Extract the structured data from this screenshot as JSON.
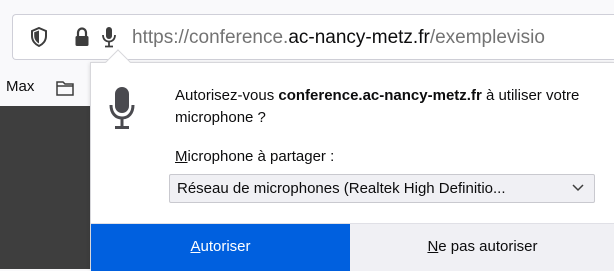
{
  "url": {
    "scheme": "https://",
    "prefix": "conference.",
    "host": "ac-nancy-metz.fr",
    "path": "/exemplevisio"
  },
  "bookmarks": {
    "label": "Max"
  },
  "icons": {
    "shield": "shield-icon",
    "lock": "lock-icon",
    "mic": "microphone-icon",
    "folder": "folder-icon",
    "chevron": "chevron-down-icon"
  },
  "prompt": {
    "text_before": "Autorisez-vous ",
    "domain": "conference.ac-nancy-metz.fr",
    "text_after": " à utiliser votre microphone ?",
    "share_label_key": "M",
    "share_label_rest": "icrophone à partager :",
    "selected_device": "Réseau de microphones (Realtek High Definitio...",
    "allow_key": "A",
    "allow_rest": "utoriser",
    "deny_key": "N",
    "deny_rest": "e pas autoriser"
  },
  "colors": {
    "accent": "#0060df",
    "content_dark": "#3e3e3e"
  }
}
